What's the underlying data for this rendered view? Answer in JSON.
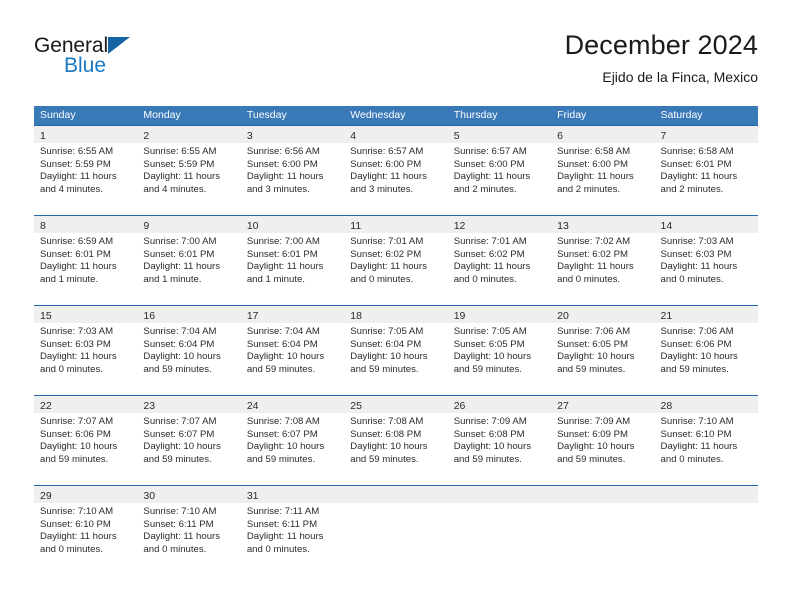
{
  "brand": {
    "name_part1": "General",
    "name_part2": "Blue",
    "triangle_color": "#1463a5",
    "blue_color": "#1a78c2"
  },
  "header": {
    "title": "December 2024",
    "subtitle": "Ejido de la Finca, Mexico"
  },
  "theme": {
    "header_row_bg": "#3a79b8",
    "row_divider": "#2566a8",
    "day_band_bg": "#efefef",
    "text": "#2b2b2b"
  },
  "weekdays": [
    "Sunday",
    "Monday",
    "Tuesday",
    "Wednesday",
    "Thursday",
    "Friday",
    "Saturday"
  ],
  "weeks": [
    [
      {
        "day": "1",
        "sunrise": "Sunrise: 6:55 AM",
        "sunset": "Sunset: 5:59 PM",
        "daylight_line1": "Daylight: 11 hours",
        "daylight_line2": "and 4 minutes."
      },
      {
        "day": "2",
        "sunrise": "Sunrise: 6:55 AM",
        "sunset": "Sunset: 5:59 PM",
        "daylight_line1": "Daylight: 11 hours",
        "daylight_line2": "and 4 minutes."
      },
      {
        "day": "3",
        "sunrise": "Sunrise: 6:56 AM",
        "sunset": "Sunset: 6:00 PM",
        "daylight_line1": "Daylight: 11 hours",
        "daylight_line2": "and 3 minutes."
      },
      {
        "day": "4",
        "sunrise": "Sunrise: 6:57 AM",
        "sunset": "Sunset: 6:00 PM",
        "daylight_line1": "Daylight: 11 hours",
        "daylight_line2": "and 3 minutes."
      },
      {
        "day": "5",
        "sunrise": "Sunrise: 6:57 AM",
        "sunset": "Sunset: 6:00 PM",
        "daylight_line1": "Daylight: 11 hours",
        "daylight_line2": "and 2 minutes."
      },
      {
        "day": "6",
        "sunrise": "Sunrise: 6:58 AM",
        "sunset": "Sunset: 6:00 PM",
        "daylight_line1": "Daylight: 11 hours",
        "daylight_line2": "and 2 minutes."
      },
      {
        "day": "7",
        "sunrise": "Sunrise: 6:58 AM",
        "sunset": "Sunset: 6:01 PM",
        "daylight_line1": "Daylight: 11 hours",
        "daylight_line2": "and 2 minutes."
      }
    ],
    [
      {
        "day": "8",
        "sunrise": "Sunrise: 6:59 AM",
        "sunset": "Sunset: 6:01 PM",
        "daylight_line1": "Daylight: 11 hours",
        "daylight_line2": "and 1 minute."
      },
      {
        "day": "9",
        "sunrise": "Sunrise: 7:00 AM",
        "sunset": "Sunset: 6:01 PM",
        "daylight_line1": "Daylight: 11 hours",
        "daylight_line2": "and 1 minute."
      },
      {
        "day": "10",
        "sunrise": "Sunrise: 7:00 AM",
        "sunset": "Sunset: 6:01 PM",
        "daylight_line1": "Daylight: 11 hours",
        "daylight_line2": "and 1 minute."
      },
      {
        "day": "11",
        "sunrise": "Sunrise: 7:01 AM",
        "sunset": "Sunset: 6:02 PM",
        "daylight_line1": "Daylight: 11 hours",
        "daylight_line2": "and 0 minutes."
      },
      {
        "day": "12",
        "sunrise": "Sunrise: 7:01 AM",
        "sunset": "Sunset: 6:02 PM",
        "daylight_line1": "Daylight: 11 hours",
        "daylight_line2": "and 0 minutes."
      },
      {
        "day": "13",
        "sunrise": "Sunrise: 7:02 AM",
        "sunset": "Sunset: 6:02 PM",
        "daylight_line1": "Daylight: 11 hours",
        "daylight_line2": "and 0 minutes."
      },
      {
        "day": "14",
        "sunrise": "Sunrise: 7:03 AM",
        "sunset": "Sunset: 6:03 PM",
        "daylight_line1": "Daylight: 11 hours",
        "daylight_line2": "and 0 minutes."
      }
    ],
    [
      {
        "day": "15",
        "sunrise": "Sunrise: 7:03 AM",
        "sunset": "Sunset: 6:03 PM",
        "daylight_line1": "Daylight: 11 hours",
        "daylight_line2": "and 0 minutes."
      },
      {
        "day": "16",
        "sunrise": "Sunrise: 7:04 AM",
        "sunset": "Sunset: 6:04 PM",
        "daylight_line1": "Daylight: 10 hours",
        "daylight_line2": "and 59 minutes."
      },
      {
        "day": "17",
        "sunrise": "Sunrise: 7:04 AM",
        "sunset": "Sunset: 6:04 PM",
        "daylight_line1": "Daylight: 10 hours",
        "daylight_line2": "and 59 minutes."
      },
      {
        "day": "18",
        "sunrise": "Sunrise: 7:05 AM",
        "sunset": "Sunset: 6:04 PM",
        "daylight_line1": "Daylight: 10 hours",
        "daylight_line2": "and 59 minutes."
      },
      {
        "day": "19",
        "sunrise": "Sunrise: 7:05 AM",
        "sunset": "Sunset: 6:05 PM",
        "daylight_line1": "Daylight: 10 hours",
        "daylight_line2": "and 59 minutes."
      },
      {
        "day": "20",
        "sunrise": "Sunrise: 7:06 AM",
        "sunset": "Sunset: 6:05 PM",
        "daylight_line1": "Daylight: 10 hours",
        "daylight_line2": "and 59 minutes."
      },
      {
        "day": "21",
        "sunrise": "Sunrise: 7:06 AM",
        "sunset": "Sunset: 6:06 PM",
        "daylight_line1": "Daylight: 10 hours",
        "daylight_line2": "and 59 minutes."
      }
    ],
    [
      {
        "day": "22",
        "sunrise": "Sunrise: 7:07 AM",
        "sunset": "Sunset: 6:06 PM",
        "daylight_line1": "Daylight: 10 hours",
        "daylight_line2": "and 59 minutes."
      },
      {
        "day": "23",
        "sunrise": "Sunrise: 7:07 AM",
        "sunset": "Sunset: 6:07 PM",
        "daylight_line1": "Daylight: 10 hours",
        "daylight_line2": "and 59 minutes."
      },
      {
        "day": "24",
        "sunrise": "Sunrise: 7:08 AM",
        "sunset": "Sunset: 6:07 PM",
        "daylight_line1": "Daylight: 10 hours",
        "daylight_line2": "and 59 minutes."
      },
      {
        "day": "25",
        "sunrise": "Sunrise: 7:08 AM",
        "sunset": "Sunset: 6:08 PM",
        "daylight_line1": "Daylight: 10 hours",
        "daylight_line2": "and 59 minutes."
      },
      {
        "day": "26",
        "sunrise": "Sunrise: 7:09 AM",
        "sunset": "Sunset: 6:08 PM",
        "daylight_line1": "Daylight: 10 hours",
        "daylight_line2": "and 59 minutes."
      },
      {
        "day": "27",
        "sunrise": "Sunrise: 7:09 AM",
        "sunset": "Sunset: 6:09 PM",
        "daylight_line1": "Daylight: 10 hours",
        "daylight_line2": "and 59 minutes."
      },
      {
        "day": "28",
        "sunrise": "Sunrise: 7:10 AM",
        "sunset": "Sunset: 6:10 PM",
        "daylight_line1": "Daylight: 11 hours",
        "daylight_line2": "and 0 minutes."
      }
    ],
    [
      {
        "day": "29",
        "sunrise": "Sunrise: 7:10 AM",
        "sunset": "Sunset: 6:10 PM",
        "daylight_line1": "Daylight: 11 hours",
        "daylight_line2": "and 0 minutes."
      },
      {
        "day": "30",
        "sunrise": "Sunrise: 7:10 AM",
        "sunset": "Sunset: 6:11 PM",
        "daylight_line1": "Daylight: 11 hours",
        "daylight_line2": "and 0 minutes."
      },
      {
        "day": "31",
        "sunrise": "Sunrise: 7:11 AM",
        "sunset": "Sunset: 6:11 PM",
        "daylight_line1": "Daylight: 11 hours",
        "daylight_line2": "and 0 minutes."
      },
      {
        "day": "",
        "sunrise": "",
        "sunset": "",
        "daylight_line1": "",
        "daylight_line2": ""
      },
      {
        "day": "",
        "sunrise": "",
        "sunset": "",
        "daylight_line1": "",
        "daylight_line2": ""
      },
      {
        "day": "",
        "sunrise": "",
        "sunset": "",
        "daylight_line1": "",
        "daylight_line2": ""
      },
      {
        "day": "",
        "sunrise": "",
        "sunset": "",
        "daylight_line1": "",
        "daylight_line2": ""
      }
    ]
  ]
}
